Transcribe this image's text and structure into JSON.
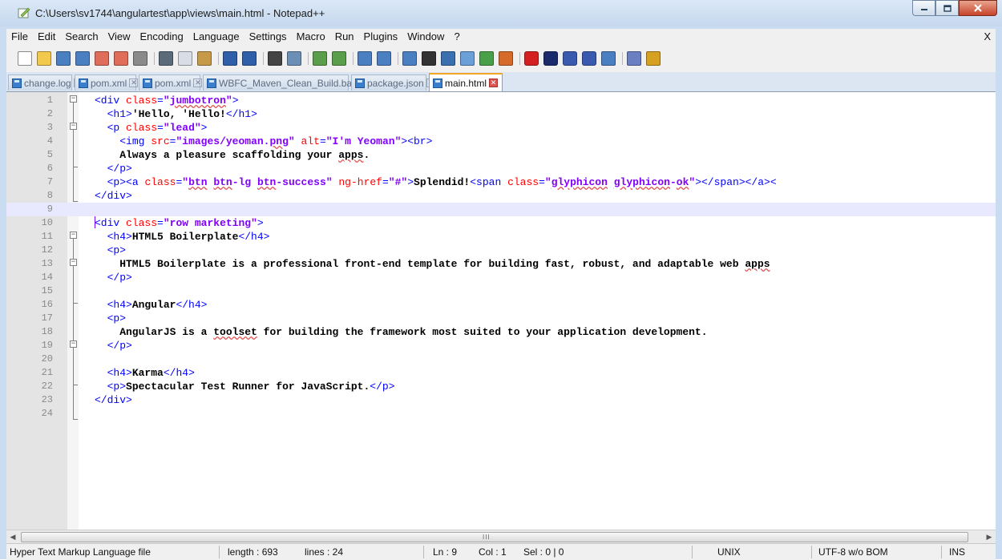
{
  "window": {
    "title": "C:\\Users\\sv1744\\angulartest\\app\\views\\main.html - Notepad++",
    "minimize_glyph": "—",
    "maximize_glyph": "□",
    "close_glyph": "✕"
  },
  "menu": {
    "items": [
      "File",
      "Edit",
      "Search",
      "View",
      "Encoding",
      "Language",
      "Settings",
      "Macro",
      "Run",
      "Plugins",
      "Window",
      "?"
    ],
    "close_label": "X"
  },
  "toolbar": {
    "icons": [
      "new-file-icon",
      "open-file-icon",
      "save-icon",
      "save-all-icon",
      "close-icon",
      "close-all-icon",
      "print-icon",
      "cut-icon",
      "copy-icon",
      "paste-icon",
      "undo-icon",
      "redo-icon",
      "find-icon",
      "replace-icon",
      "zoom-in-icon",
      "zoom-out-icon",
      "sync-vertical-icon",
      "sync-horizontal-icon",
      "word-wrap-icon",
      "show-all-characters-icon",
      "indent-guide-icon",
      "user-language-icon",
      "doc-map-icon",
      "function-list-icon",
      "record-macro-icon",
      "stop-macro-icon",
      "play-macro-icon",
      "run-macro-multiple-icon",
      "save-macro-icon",
      "spell-check-icon",
      "plugin-icon"
    ]
  },
  "tabs": [
    {
      "label": "change.log",
      "active": false
    },
    {
      "label": "pom.xml",
      "active": false
    },
    {
      "label": "pom.xml",
      "active": false
    },
    {
      "label": "WBFC_Maven_Clean_Build.bat",
      "active": false
    },
    {
      "label": "package.json",
      "active": false
    },
    {
      "label": "main.html",
      "active": true
    }
  ],
  "tab_close_glyph": "✕",
  "editor": {
    "current_line": 9,
    "lines": [
      {
        "n": "1",
        "code": "<div class=\"jumbotron\">"
      },
      {
        "n": "2",
        "code": "  <h1>'Hello, 'Hello!</h1>"
      },
      {
        "n": "3",
        "code": "  <p class=\"lead\">"
      },
      {
        "n": "4",
        "code": "    <img src=\"images/yeoman.png\" alt=\"I'm Yeoman\"><br>"
      },
      {
        "n": "5",
        "code": "    Always a pleasure scaffolding your apps."
      },
      {
        "n": "6",
        "code": "  </p>"
      },
      {
        "n": "7",
        "code": "  <p><a class=\"btn btn-lg btn-success\" ng-href=\"#\">Splendid!<span class=\"glyphicon glyphicon-ok\"></span></a><"
      },
      {
        "n": "8",
        "code": "</div>"
      },
      {
        "n": "9",
        "code": ""
      },
      {
        "n": "10",
        "code": "<div class=\"row marketing\">"
      },
      {
        "n": "11",
        "code": "  <h4>HTML5 Boilerplate</h4>"
      },
      {
        "n": "12",
        "code": "  <p>"
      },
      {
        "n": "13",
        "code": "    HTML5 Boilerplate is a professional front-end template for building fast, robust, and adaptable web apps"
      },
      {
        "n": "14",
        "code": "  </p>"
      },
      {
        "n": "15",
        "code": ""
      },
      {
        "n": "16",
        "code": "  <h4>Angular</h4>"
      },
      {
        "n": "17",
        "code": "  <p>"
      },
      {
        "n": "18",
        "code": "    AngularJS is a toolset for building the framework most suited to your application development."
      },
      {
        "n": "19",
        "code": "  </p>"
      },
      {
        "n": "20",
        "code": ""
      },
      {
        "n": "21",
        "code": "  <h4>Karma</h4>"
      },
      {
        "n": "22",
        "code": "  <p>Spectacular Test Runner for JavaScript.</p>"
      },
      {
        "n": "23",
        "code": "</div>"
      },
      {
        "n": "24",
        "code": ""
      }
    ]
  },
  "scrollbar": {
    "left_arrow": "◀",
    "right_arrow": "▶",
    "grip": "III"
  },
  "status": {
    "file_type": "Hyper Text Markup Language file",
    "length": "length : 693",
    "lines": "lines : 24",
    "ln": "Ln : 9",
    "col": "Col : 1",
    "sel": "Sel : 0 | 0",
    "eol": "UNIX",
    "encoding": "UTF-8 w/o BOM",
    "ins": "INS"
  },
  "colors": {
    "tag": "#0000ff",
    "attribute": "#ff0000",
    "attribute_value": "#8000ff",
    "active_tab_accent": "#f5a623",
    "current_line": "#e8e8ff"
  }
}
